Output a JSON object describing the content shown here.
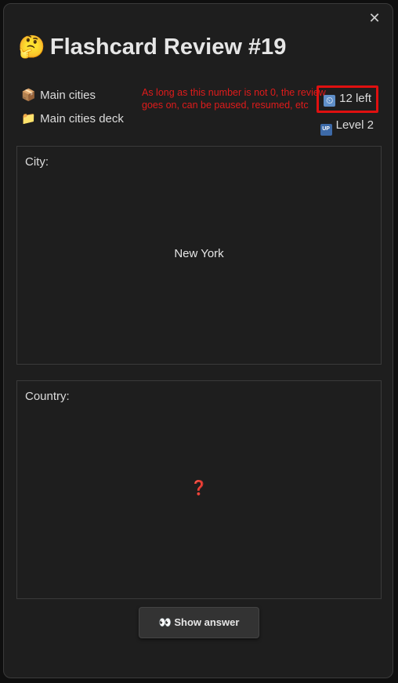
{
  "modal": {
    "title": "Flashcard Review #19",
    "title_icon": "🤔",
    "close_label": "✕"
  },
  "meta": {
    "deck_icon": "📦",
    "deck_name": "Main cities",
    "folder_icon": "📁",
    "folder_name": "Main cities deck",
    "remaining_icon": "⏲",
    "remaining_label": "12 left",
    "level_icon": "UP",
    "level_label": "Level 2"
  },
  "annotation": {
    "text": "As long as this number is not 0, the review goes on, can be paused, resumed, etc",
    "color": "#e01b1b"
  },
  "front": {
    "label": "City:",
    "value": "New York"
  },
  "back": {
    "label": "Country:",
    "value": "❓"
  },
  "actions": {
    "show_answer_icon": "👀",
    "show_answer_label": "Show answer"
  },
  "colors": {
    "background": "#1e1e1e",
    "highlight_border": "#e01010",
    "question_mark": "#e63a3a"
  }
}
